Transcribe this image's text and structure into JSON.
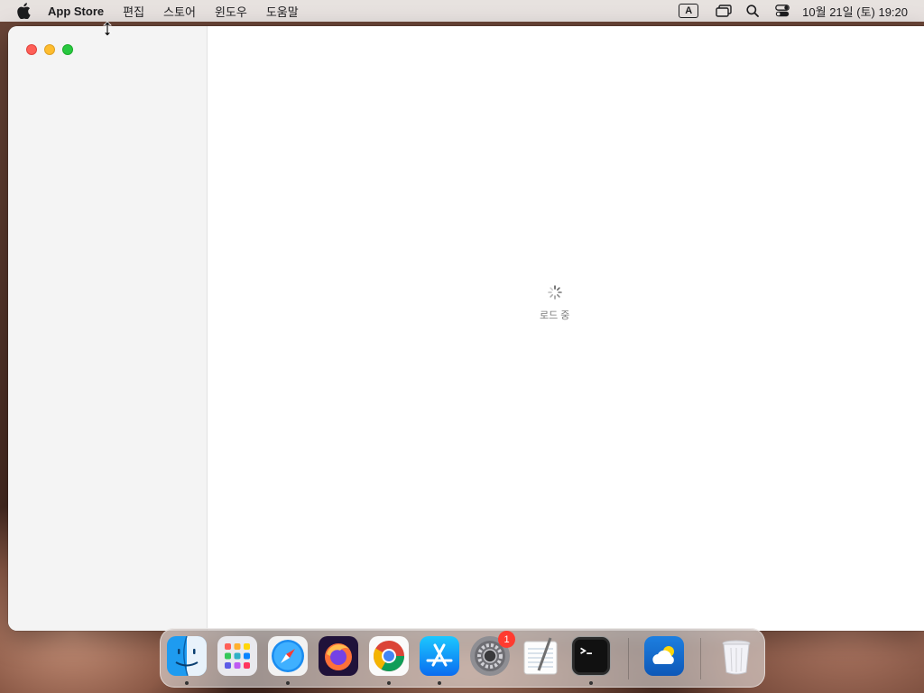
{
  "menubar": {
    "app_name": "App Store",
    "menus": [
      "편집",
      "스토어",
      "윈도우",
      "도움말"
    ],
    "input_source": "A",
    "clock": "10월 21일 (토) 19:20"
  },
  "content": {
    "loading_label": "로드 중"
  },
  "dock": {
    "apps": [
      {
        "name": "finder-icon",
        "running": true
      },
      {
        "name": "launchpad-icon",
        "running": false
      },
      {
        "name": "safari-icon",
        "running": true
      },
      {
        "name": "firefox-icon",
        "running": false
      },
      {
        "name": "chrome-icon",
        "running": true
      },
      {
        "name": "app-store-icon",
        "running": true
      },
      {
        "name": "system-settings-icon",
        "running": false,
        "badge": "1"
      },
      {
        "name": "textedit-icon",
        "running": false
      },
      {
        "name": "terminal-icon",
        "running": true
      },
      {
        "name": "weather-icon",
        "running": false
      },
      {
        "name": "trash-icon",
        "running": false
      }
    ]
  },
  "colors": {
    "close": "#fe5f57",
    "minimize": "#febc2e",
    "maximize": "#28c840",
    "badge": "#ff3b30"
  }
}
